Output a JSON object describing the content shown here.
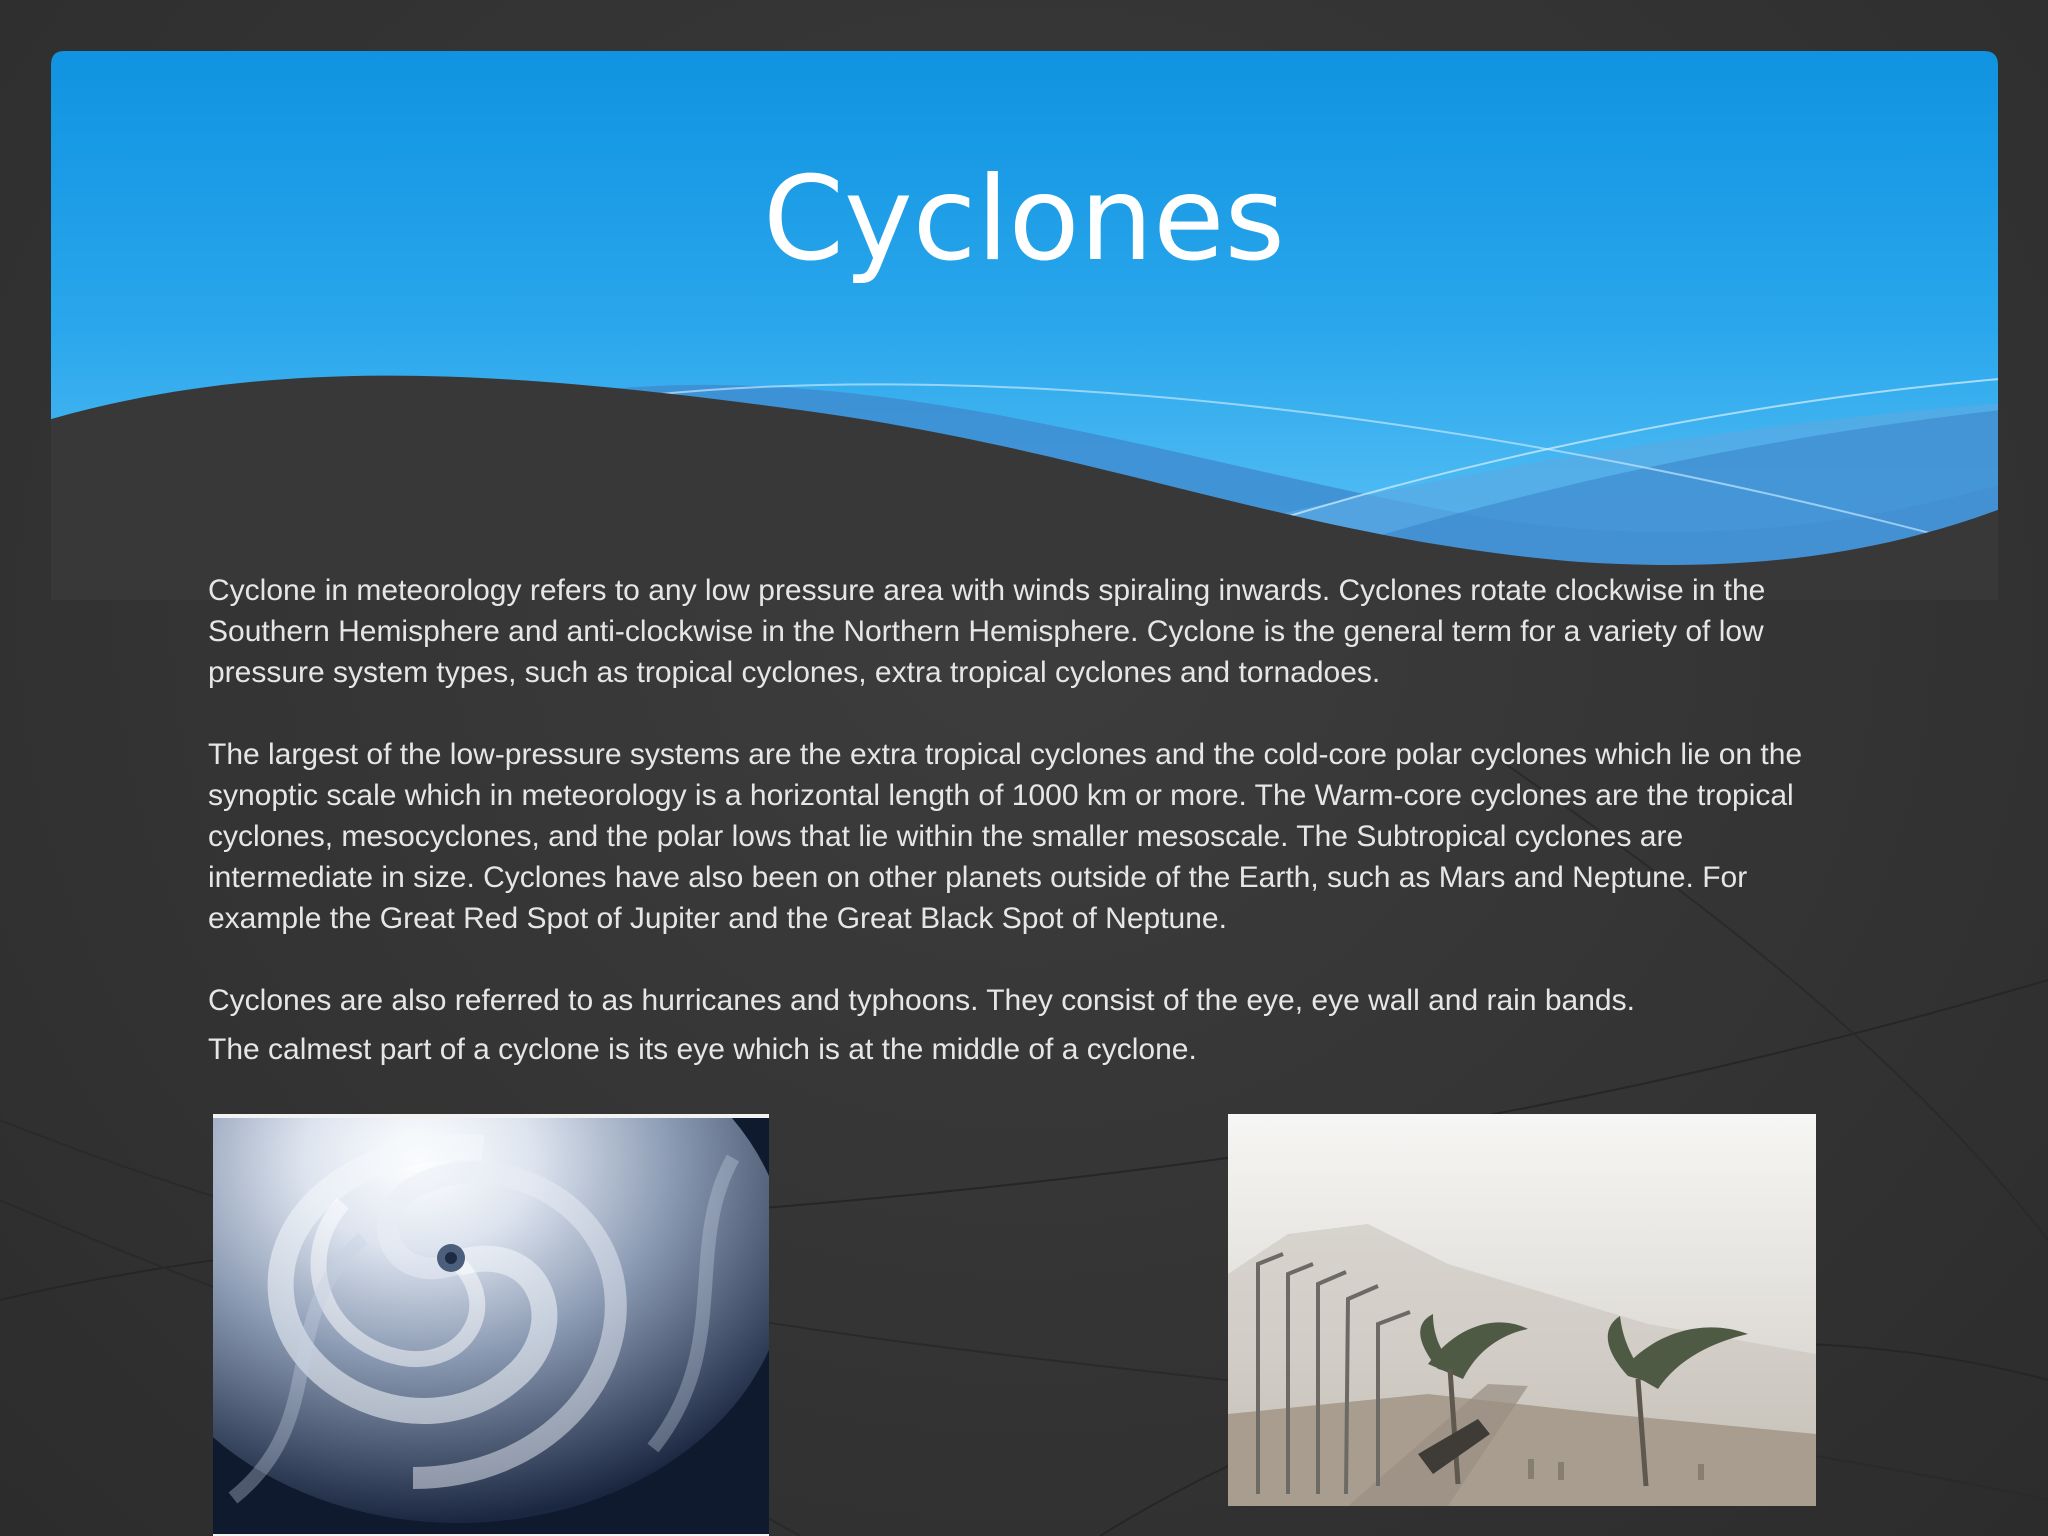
{
  "slide": {
    "title": "Cyclones",
    "paragraphs": [
      "Cyclone in meteorology refers to any low pressure area with winds spiraling inwards. Cyclones rotate clockwise in the Southern Hemisphere and anti-clockwise in the Northern Hemisphere. Cyclone is the general term for a variety of low pressure system types, such as tropical cyclones, extra tropical cyclones and tornadoes.",
      "The largest of the low-pressure systems are the extra tropical cyclones and the cold-core polar cyclones which lie on the synoptic scale which in meteorology is a horizontal length of 1000 km or more. The Warm-core cyclones are the tropical cyclones, mesocyclones, and the polar lows that lie within the smaller mesoscale. The Subtropical cyclones are intermediate in size. Cyclones have also been on other planets outside of the Earth, such as Mars and Neptune. For example the Great Red Spot of Jupiter and the Great Black Spot of Neptune.",
      "Cyclones are also referred to as hurricanes and typhoons. They consist of the eye, eye wall and rain bands.",
      "The calmest part of a cyclone is its eye which is at the middle of a cyclone."
    ]
  },
  "images": {
    "left": "satellite view of a cyclone with a central eye",
    "right": "palm trees and street lamps bent by storm winds along a seafront"
  },
  "colors": {
    "background": "#333333",
    "banner_top": "#0b8fde",
    "banner_bottom": "#5ec2f5",
    "title_text": "#ffffff",
    "body_text": "#e6e6e6"
  }
}
